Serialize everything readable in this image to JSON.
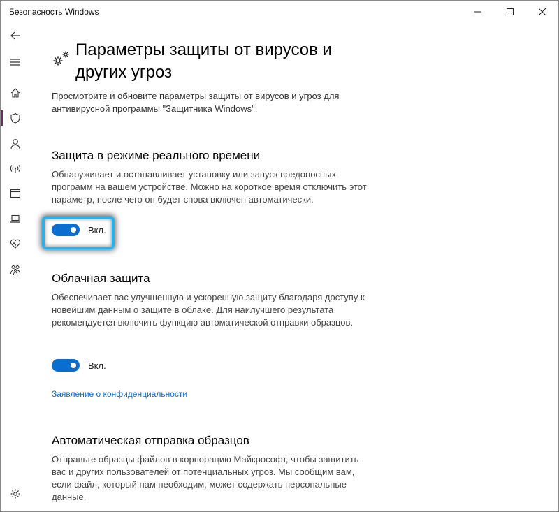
{
  "window": {
    "title": "Безопасность Windows",
    "minimize_icon": "minimize-icon",
    "maximize_icon": "maximize-icon",
    "close_icon": "close-icon"
  },
  "sidebar": {
    "items": [
      {
        "name": "back",
        "icon": "back-arrow-icon"
      },
      {
        "name": "menu",
        "icon": "hamburger-icon"
      },
      {
        "name": "home",
        "icon": "home-icon"
      },
      {
        "name": "virus-protection",
        "icon": "shield-icon",
        "active": true
      },
      {
        "name": "account",
        "icon": "person-icon"
      },
      {
        "name": "firewall",
        "icon": "wifi-icon"
      },
      {
        "name": "app-browser",
        "icon": "browser-window-icon"
      },
      {
        "name": "device-security",
        "icon": "laptop-icon"
      },
      {
        "name": "device-health",
        "icon": "heart-pulse-icon"
      },
      {
        "name": "family",
        "icon": "family-icon"
      },
      {
        "name": "settings",
        "icon": "gear-icon"
      }
    ],
    "accent": "#6b2d60"
  },
  "main": {
    "title": "Параметры защиты от вирусов и других угроз",
    "description": "Просмотрите и обновите параметры защиты от вирусов и угроз для антивирусной программы \"Защитника Windows\".",
    "sections": [
      {
        "title": "Защита в режиме реального времени",
        "description": "Обнаруживает и останавливает установку или запуск вредоносных программ на вашем устройстве. Можно на короткое время отключить этот параметр, после чего он будет снова включен автоматически.",
        "toggle_label": "Вкл.",
        "toggle_on": true
      },
      {
        "title": "Облачная защита",
        "description": "Обеспечивает вас улучшенную и ускоренную защиту благодаря доступу к новейшим данным о защите в облаке. Для наилучшего результата рекомендуется включить функцию автоматической отправки образцов.",
        "toggle_label": "Вкл.",
        "toggle_on": true,
        "link": "Заявление о конфиденциальности"
      },
      {
        "title": "Автоматическая отправка образцов",
        "description": "Отправьте образцы файлов в корпорацию Майкрософт, чтобы защитить вас и других пользователей от потенциальных угроз. Мы сообщим вам, если файл, который нам необходим, может содержать персональные данные."
      }
    ]
  },
  "colors": {
    "toggle_on": "#0a6ed1",
    "link": "#0a6ed1",
    "highlight": "#2bb1e8"
  }
}
